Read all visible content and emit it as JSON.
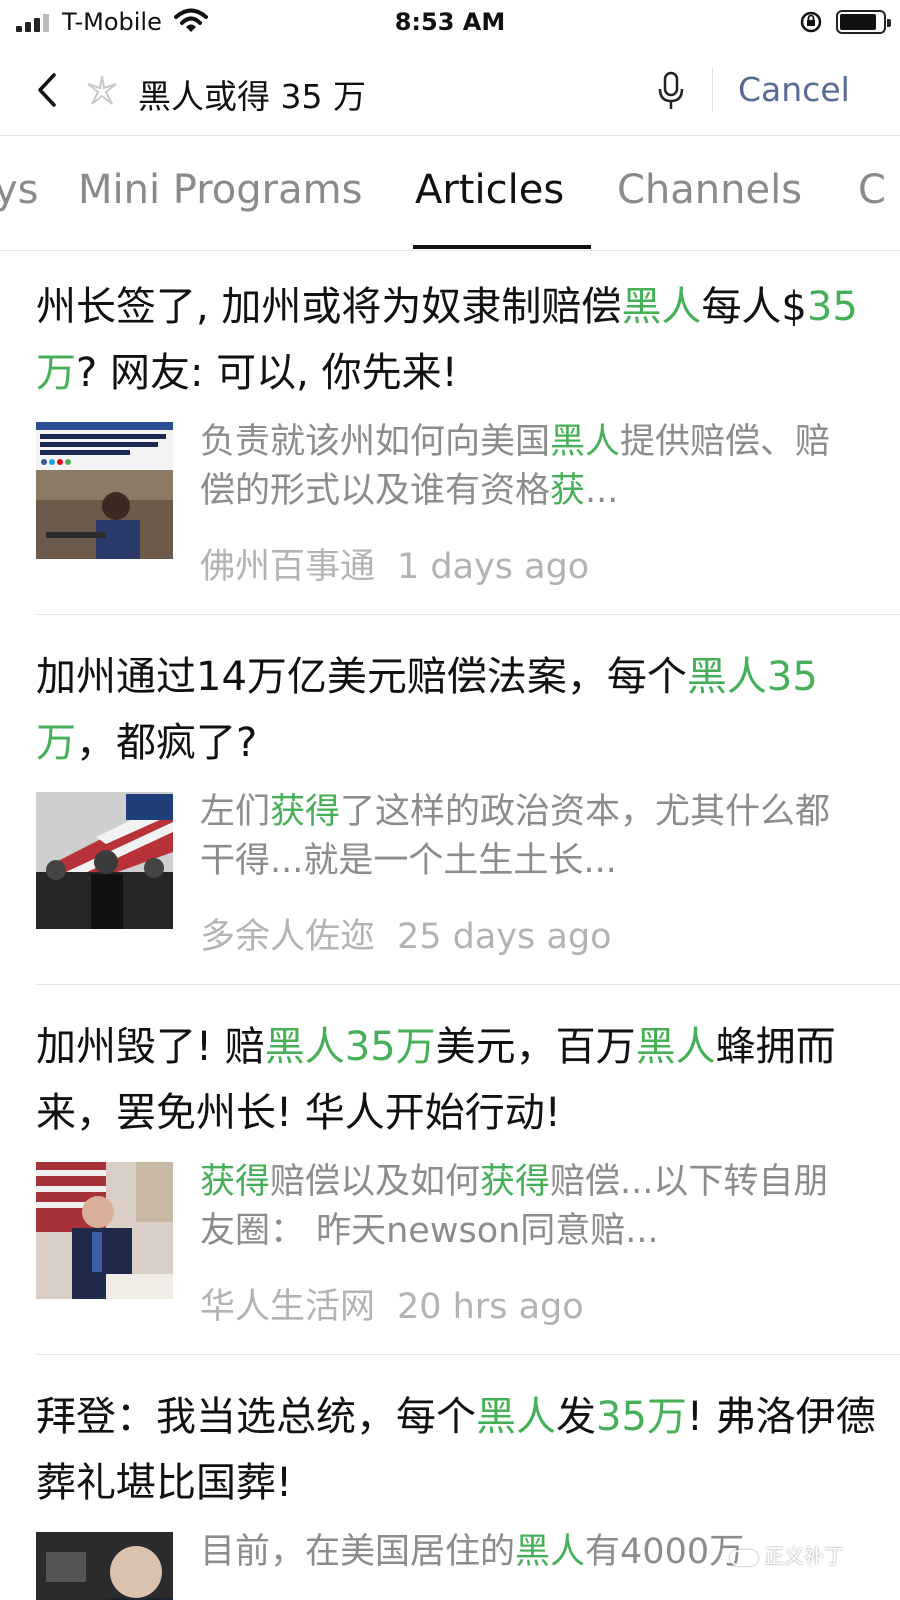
{
  "status_bar": {
    "carrier": "T-Mobile",
    "time": "8:53 AM"
  },
  "search": {
    "query": "黑人或得 35 万",
    "cancel_label": "Cancel"
  },
  "tabs": [
    {
      "label": "ys"
    },
    {
      "label": "Mini Programs"
    },
    {
      "label": "Articles",
      "active": true
    },
    {
      "label": "Channels"
    },
    {
      "label": "C"
    }
  ],
  "colors": {
    "highlight": "#46b058",
    "link": "#576b95"
  },
  "articles": [
    {
      "title_parts": [
        {
          "text": "州长签了, 加州或将为奴隶制赔偿"
        },
        {
          "text": "黑人",
          "hl": true
        },
        {
          "text": "每人$"
        },
        {
          "text": "35万",
          "hl": true
        },
        {
          "text": "? 网友: 可以, 你先来!"
        }
      ],
      "thumbnail_text": "California task force will consider paying reparations for slavery under bill signed by Gov. Newsom",
      "snippet_parts": [
        {
          "text": "负责就该州如何向美国"
        },
        {
          "text": "黑人",
          "hl": true
        },
        {
          "text": "提供赔偿、赔偿的形式以及谁有资格"
        },
        {
          "text": "获",
          "hl": true
        },
        {
          "text": "..."
        }
      ],
      "source": "佛州百事通",
      "time": "1 days ago"
    },
    {
      "title_parts": [
        {
          "text": "加州通过14万亿美元赔偿法案，每个"
        },
        {
          "text": "黑人35万",
          "hl": true
        },
        {
          "text": "，都疯了?"
        }
      ],
      "snippet_parts": [
        {
          "text": "左们"
        },
        {
          "text": "获得",
          "hl": true
        },
        {
          "text": "了这样的政治资本，尤其什么都干得...就是一个土生土长..."
        }
      ],
      "source": "多余人佐迩",
      "time": "25 days ago"
    },
    {
      "title_parts": [
        {
          "text": "加州毁了! 赔"
        },
        {
          "text": "黑人35万",
          "hl": true
        },
        {
          "text": "美元，百万"
        },
        {
          "text": "黑人",
          "hl": true
        },
        {
          "text": "蜂拥而来，罢免州长! 华人开始行动!"
        }
      ],
      "snippet_parts": [
        {
          "text": "获得",
          "hl": true
        },
        {
          "text": "赔偿以及如何"
        },
        {
          "text": "获得",
          "hl": true
        },
        {
          "text": "赔偿...以下转自朋友圈： 昨天newson同意赔..."
        }
      ],
      "source": "华人生活网",
      "time": "20 hrs ago"
    },
    {
      "title_parts": [
        {
          "text": "拜登：我当选总统，每个"
        },
        {
          "text": "黑人",
          "hl": true
        },
        {
          "text": "发"
        },
        {
          "text": "35万",
          "hl": true
        },
        {
          "text": "! 弗洛伊德葬礼堪比国葬!"
        }
      ],
      "snippet_parts": [
        {
          "text": "目前，在美国居住的"
        },
        {
          "text": "黑人",
          "hl": true
        },
        {
          "text": "有4000万"
        }
      ],
      "source": "",
      "time": ""
    }
  ],
  "watermark": "正义补丁"
}
